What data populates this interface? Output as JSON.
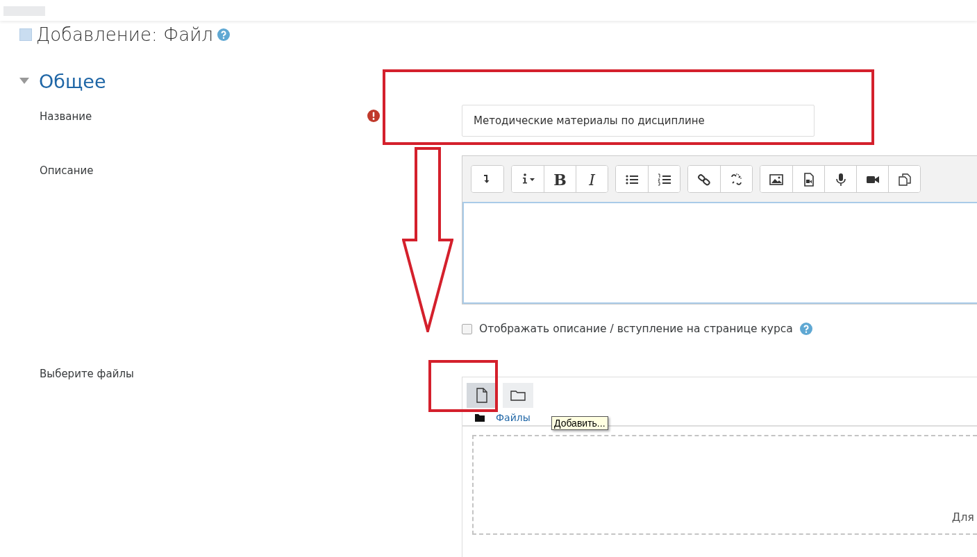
{
  "page_title": "Добавление: Файл",
  "section": {
    "title": "Общее",
    "expanded": true
  },
  "name_field": {
    "label": "Название",
    "required": true,
    "value": "Методические материалы по дисциплине"
  },
  "description": {
    "label": "Описание",
    "toolbar": [
      [
        {
          "kind": "icon"
        }
      ],
      [
        {
          "kind": "icon"
        },
        {
          "kind": "text",
          "label": "B"
        },
        {
          "kind": "text",
          "label": "I"
        }
      ],
      [
        {
          "kind": "icon"
        },
        {
          "kind": "icon"
        }
      ],
      [
        {
          "kind": "icon"
        },
        {
          "kind": "icon"
        }
      ],
      [
        {
          "kind": "icon"
        },
        {
          "kind": "icon"
        },
        {
          "kind": "icon"
        },
        {
          "kind": "icon"
        },
        {
          "kind": "icon"
        }
      ]
    ]
  },
  "show_description": {
    "label": "Отображать описание / вступление на странице курса",
    "checked": false
  },
  "files": {
    "label": "Выберите файлы",
    "buttons": [
      {
        "selected": true
      },
      {
        "selected": false
      }
    ],
    "path_link": "Файлы",
    "tooltip": "Добавить...",
    "drop_text": "Для"
  }
}
